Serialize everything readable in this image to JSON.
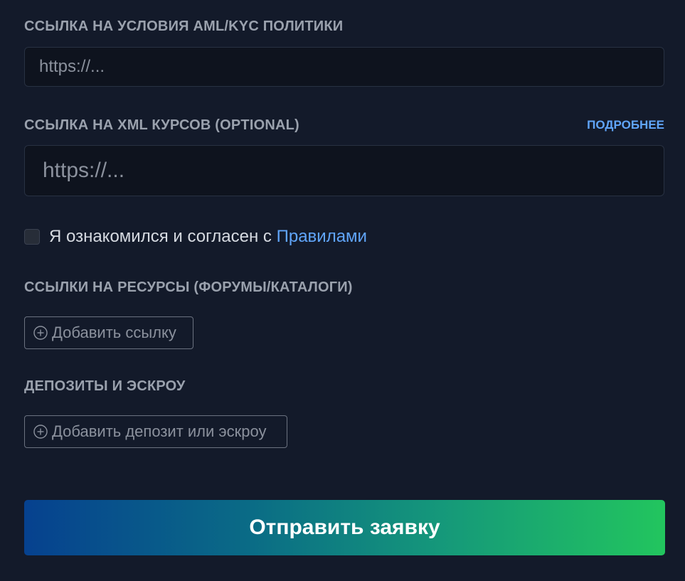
{
  "aml": {
    "label": "ССЫЛКА НА УСЛОВИЯ AML/KYC ПОЛИТИКИ",
    "placeholder": "https://..."
  },
  "xml": {
    "label": "ССЫЛКА НА XML КУРСОВ (OPTIONAL)",
    "more_link": "ПОДРОБНЕЕ",
    "placeholder": "https://..."
  },
  "agreement": {
    "text": "Я ознакомился и согласен с",
    "link": "Правилами",
    "checked": false
  },
  "resources": {
    "label": "ССЫЛКИ НА РЕСУРСЫ (ФОРУМЫ/КАТАЛОГИ)",
    "add_button": "Добавить ссылку",
    "icon": "plus-circle-icon"
  },
  "deposits": {
    "label": "ДЕПОЗИТЫ И ЭСКРОУ",
    "add_button": "Добавить депозит или эскроу",
    "icon": "plus-circle-icon"
  },
  "submit": {
    "label": "Отправить заявку"
  },
  "colors": {
    "background": "#131a2a",
    "accent_link": "#60a5fa",
    "gradient_start": "#06418f",
    "gradient_end": "#22c55e"
  }
}
